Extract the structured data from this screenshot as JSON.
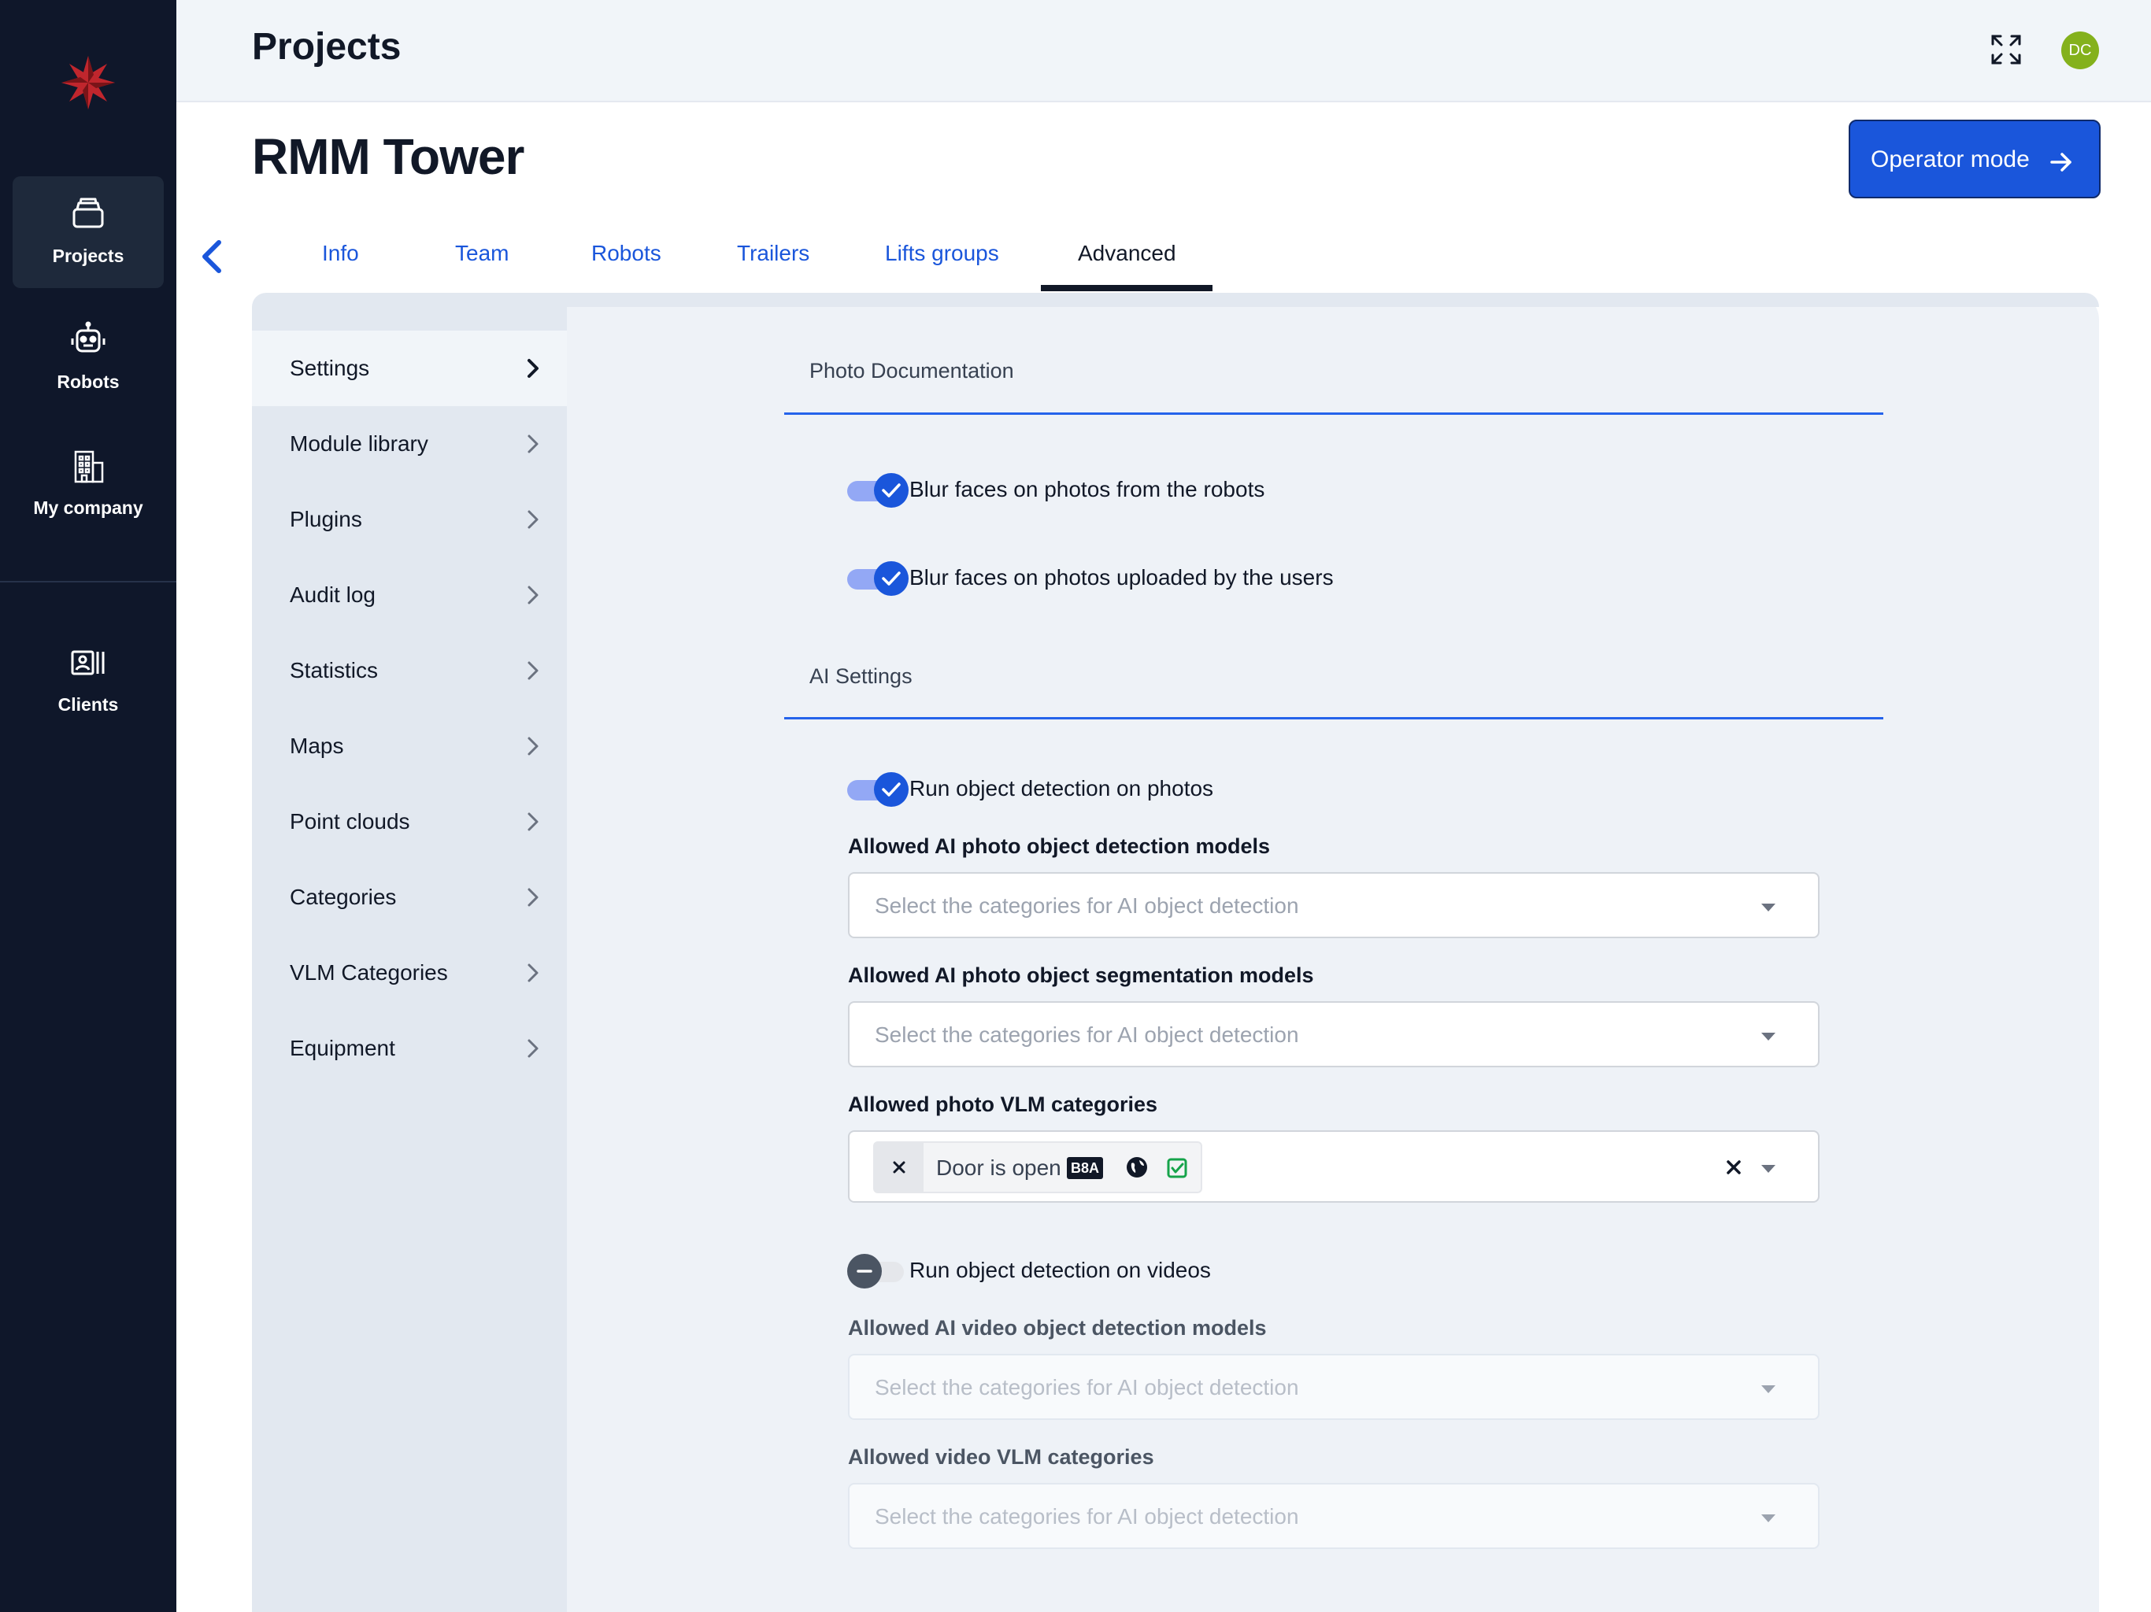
{
  "app_nav": [
    {
      "label": "Projects",
      "icon": "projects-icon",
      "active": true
    },
    {
      "label": "Robots",
      "icon": "robot-icon",
      "active": false
    },
    {
      "label": "My company",
      "icon": "building-icon",
      "active": false
    },
    {
      "label": "Clients",
      "icon": "clients-icon",
      "active": false
    }
  ],
  "topbar": {
    "title": "Projects",
    "avatar_initials": "DC"
  },
  "project": {
    "title": "RMM Tower",
    "operator_button": "Operator mode"
  },
  "tabs": [
    {
      "label": "Info"
    },
    {
      "label": "Team"
    },
    {
      "label": "Robots"
    },
    {
      "label": "Trailers"
    },
    {
      "label": "Lifts groups"
    },
    {
      "label": "Advanced",
      "active": true
    }
  ],
  "subnav": [
    {
      "label": "Settings",
      "active": true
    },
    {
      "label": "Module library"
    },
    {
      "label": "Plugins"
    },
    {
      "label": "Audit log"
    },
    {
      "label": "Statistics"
    },
    {
      "label": "Maps"
    },
    {
      "label": "Point clouds"
    },
    {
      "label": "Categories"
    },
    {
      "label": "VLM Categories"
    },
    {
      "label": "Equipment"
    }
  ],
  "photo_doc": {
    "title": "Photo Documentation",
    "blur_robots": {
      "label": "Blur faces on photos from the robots",
      "on": true
    },
    "blur_users": {
      "label": "Blur faces on photos uploaded by the users",
      "on": true
    }
  },
  "ai": {
    "title": "AI Settings",
    "run_photos": {
      "label": "Run object detection on photos",
      "on": true
    },
    "photo_detection": {
      "label": "Allowed AI photo object detection models",
      "placeholder": "Select the categories for AI object detection"
    },
    "photo_segmentation": {
      "label": "Allowed AI photo object segmentation models",
      "placeholder": "Select the categories for AI object detection"
    },
    "photo_vlm": {
      "label": "Allowed photo VLM categories",
      "chip_text": "Door is open",
      "chip_badge": "B8A"
    },
    "run_videos": {
      "label": "Run object detection on videos",
      "on": false
    },
    "video_detection": {
      "label": "Allowed AI video object detection models",
      "placeholder": "Select the categories for AI object detection"
    },
    "video_vlm": {
      "label": "Allowed video VLM categories",
      "placeholder": "Select the categories for AI object detection"
    }
  },
  "colors": {
    "accent": "#1a56db",
    "sidebar": "#0f172a",
    "avatar": "#84b11c",
    "toggle_track": "#93a8f5"
  }
}
